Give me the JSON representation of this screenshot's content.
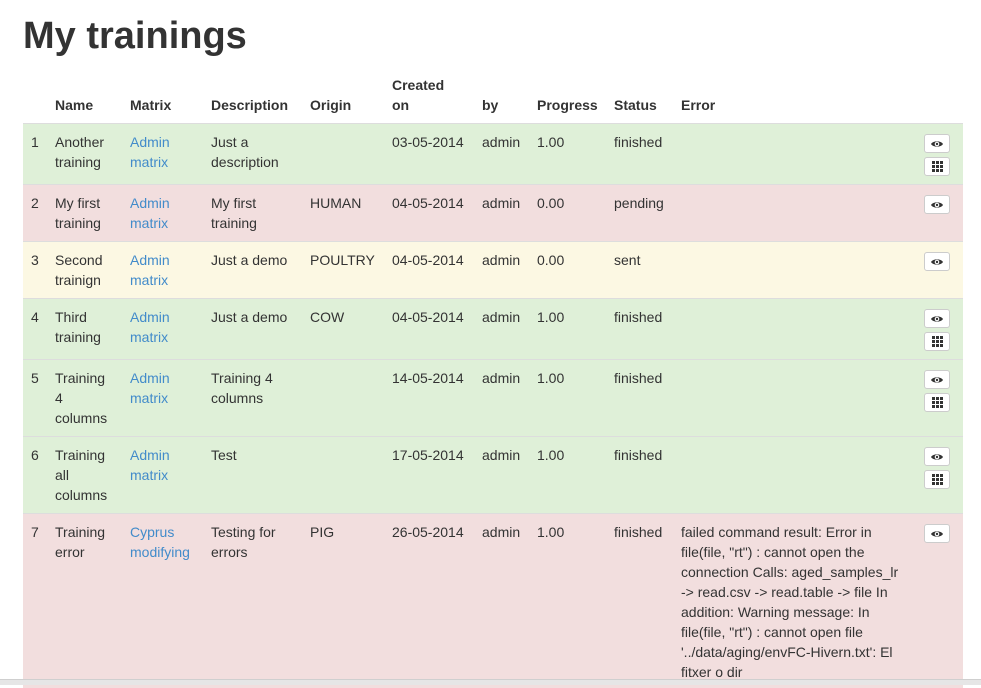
{
  "page": {
    "title": "My trainings"
  },
  "table": {
    "headers": {
      "name": "Name",
      "matrix": "Matrix",
      "description": "Description",
      "origin": "Origin",
      "created_line1": "Created",
      "created_line2": "on",
      "by": "by",
      "progress": "Progress",
      "status": "Status",
      "error": "Error"
    },
    "rows": [
      {
        "num": "1",
        "name": [
          "Another",
          "training"
        ],
        "matrix": [
          "Admin",
          "matrix"
        ],
        "description": [
          "Just a",
          "description"
        ],
        "origin": "",
        "created": "03-05-2014",
        "by": "admin",
        "progress": "1.00",
        "status": "finished",
        "error": [],
        "buttons": [
          "view-icon",
          "matrix-icon"
        ],
        "state": "success"
      },
      {
        "num": "2",
        "name": [
          "My first",
          "training"
        ],
        "matrix": [
          "Admin",
          "matrix"
        ],
        "description": [
          "My first",
          "training"
        ],
        "origin": "HUMAN",
        "created": "04-05-2014",
        "by": "admin",
        "progress": "0.00",
        "status": "pending",
        "error": [],
        "buttons": [
          "view-icon"
        ],
        "state": "danger"
      },
      {
        "num": "3",
        "name": [
          "Second",
          "trainign"
        ],
        "matrix": [
          "Admin",
          "matrix"
        ],
        "description": [
          "Just a demo"
        ],
        "origin": "POULTRY",
        "created": "04-05-2014",
        "by": "admin",
        "progress": "0.00",
        "status": "sent",
        "error": [],
        "buttons": [
          "view-icon"
        ],
        "state": "warning"
      },
      {
        "num": "4",
        "name": [
          "Third",
          "training"
        ],
        "matrix": [
          "Admin",
          "matrix"
        ],
        "description": [
          "Just a demo"
        ],
        "origin": "COW",
        "created": "04-05-2014",
        "by": "admin",
        "progress": "1.00",
        "status": "finished",
        "error": [],
        "buttons": [
          "view-icon",
          "matrix-icon"
        ],
        "state": "success"
      },
      {
        "num": "5",
        "name": [
          "Training",
          "4",
          "columns"
        ],
        "matrix": [
          "Admin",
          "matrix"
        ],
        "description": [
          "Training 4",
          "columns"
        ],
        "origin": "",
        "created": "14-05-2014",
        "by": "admin",
        "progress": "1.00",
        "status": "finished",
        "error": [],
        "buttons": [
          "view-icon",
          "matrix-icon"
        ],
        "state": "success"
      },
      {
        "num": "6",
        "name": [
          "Training",
          "all",
          "columns"
        ],
        "matrix": [
          "Admin",
          "matrix"
        ],
        "description": [
          "Test"
        ],
        "origin": "",
        "created": "17-05-2014",
        "by": "admin",
        "progress": "1.00",
        "status": "finished",
        "error": [],
        "buttons": [
          "view-icon",
          "matrix-icon"
        ],
        "state": "success"
      },
      {
        "num": "7",
        "name": [
          "Training",
          "error"
        ],
        "matrix": [
          "Cyprus",
          "modifying"
        ],
        "description": [
          "Testing for",
          "errors"
        ],
        "origin": "PIG",
        "created": "26-05-2014",
        "by": "admin",
        "progress": "1.00",
        "status": "finished",
        "error": [
          "failed command result: Error in",
          "file(file, \"rt\") : cannot open the",
          "connection Calls: aged_samples_lr",
          "-> read.csv -> read.table -> file In",
          "addition: Warning message: In",
          "file(file, \"rt\") : cannot open file",
          "'../data/aging/envFC-Hivern.txt': El",
          "fitxer o dir"
        ],
        "buttons": [
          "view-icon"
        ],
        "state": "danger"
      }
    ]
  },
  "colors": {
    "success": "#dff0d8",
    "danger": "#f2dede",
    "warning": "#fcf8e3",
    "link": "#428bca"
  }
}
